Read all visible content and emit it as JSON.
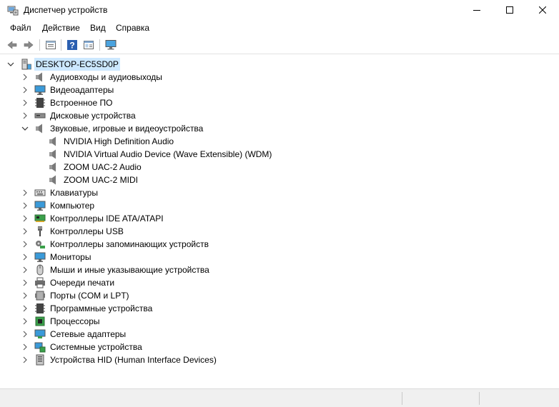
{
  "window": {
    "title": "Диспетчер устройств"
  },
  "menu": {
    "items": [
      "Файл",
      "Действие",
      "Вид",
      "Справка"
    ]
  },
  "toolbar": {
    "buttons": [
      "back-icon",
      "forward-icon",
      "properties-icon",
      "help-icon",
      "view-icon",
      "monitor-icon"
    ]
  },
  "tree": {
    "root": "DESKTOP-EC5SD0P",
    "categories": [
      "Аудиовходы и аудиовыходы",
      "Видеоадаптеры",
      "Встроенное ПО",
      "Дисковые устройства",
      "Звуковые, игровые и видеоустройства",
      "Клавиатуры",
      "Компьютер",
      "Контроллеры IDE ATA/ATAPI",
      "Контроллеры USB",
      "Контроллеры запоминающих устройств",
      "Мониторы",
      "Мыши и иные указывающие устройства",
      "Очереди печати",
      "Порты (COM и LPT)",
      "Программные устройства",
      "Процессоры",
      "Сетевые адаптеры",
      "Системные устройства",
      "Устройства HID (Human Interface Devices)"
    ],
    "expanded_children": [
      "NVIDIA High Definition Audio",
      "NVIDIA Virtual Audio Device (Wave Extensible) (WDM)",
      "ZOOM UAC-2 Audio",
      "ZOOM UAC-2 MIDI"
    ]
  },
  "colors": {
    "selection": "#cce8ff",
    "statusbar": "#f0f0f0"
  }
}
